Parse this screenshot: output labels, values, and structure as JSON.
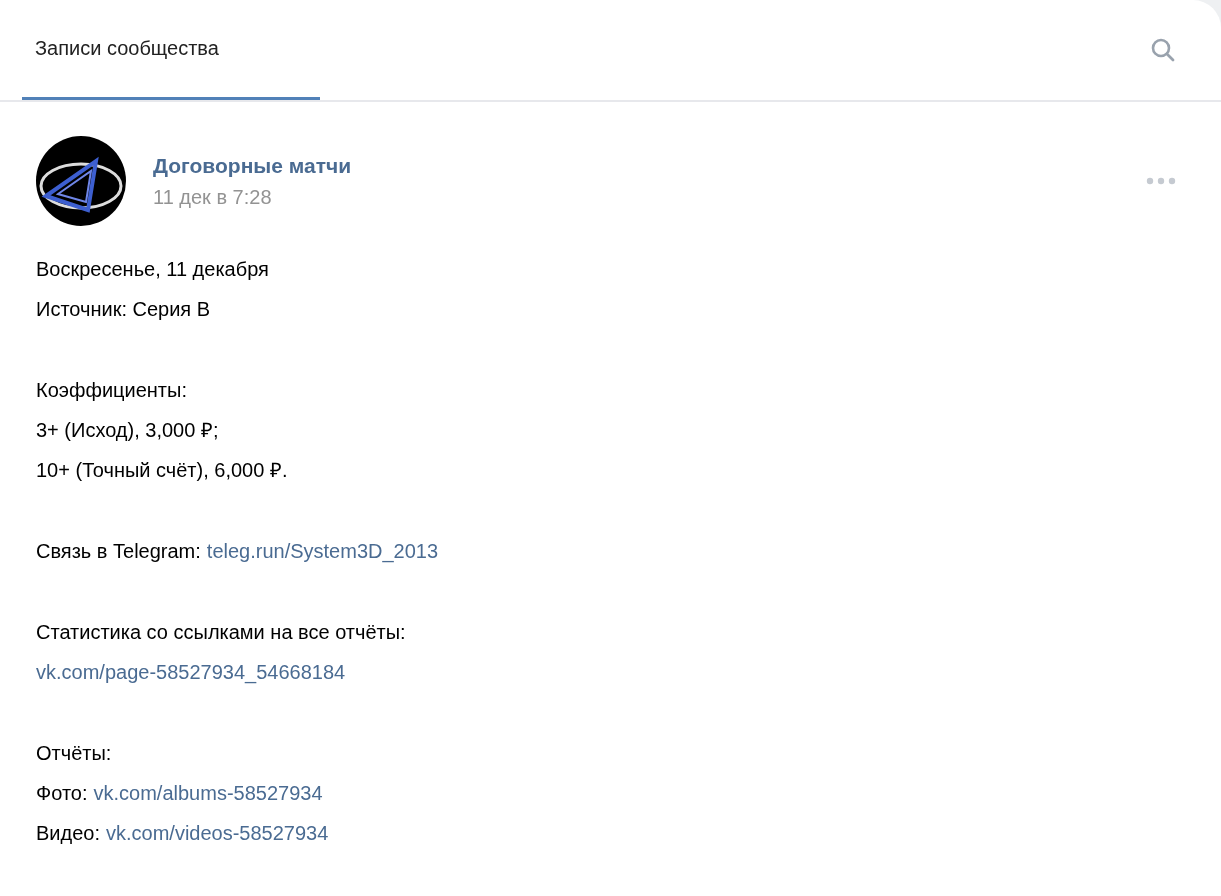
{
  "tabs": [
    {
      "label": "Записи сообщества",
      "selected": true
    }
  ],
  "post": {
    "author": "Договорные матчи",
    "date": "11 дек в 7:28",
    "paragraphs": [
      [
        [
          {
            "kind": "text",
            "text": "Воскресенье, 11 декабря"
          }
        ],
        [
          {
            "kind": "text",
            "text": "Источник: Серия B"
          }
        ]
      ],
      [
        [
          {
            "kind": "text",
            "text": "Коэффициенты:"
          }
        ],
        [
          {
            "kind": "text",
            "text": "3+ (Исход), 3,000 ₽;"
          }
        ],
        [
          {
            "kind": "text",
            "text": "10+ (Точный счёт), 6,000 ₽."
          }
        ]
      ],
      [
        [
          {
            "kind": "text",
            "text": "Связь в Telegram:"
          },
          {
            "kind": "link",
            "text": "teleg.run/System3D_2013"
          }
        ]
      ],
      [
        [
          {
            "kind": "text",
            "text": "Статистика со ссылками на все отчёты:"
          }
        ],
        [
          {
            "kind": "link",
            "text": "vk.com/page-58527934_54668184"
          }
        ]
      ],
      [
        [
          {
            "kind": "text",
            "text": "Отчёты:"
          }
        ],
        [
          {
            "kind": "text",
            "text": "Фото:"
          },
          {
            "kind": "link",
            "text": "vk.com/albums-58527934"
          }
        ],
        [
          {
            "kind": "text",
            "text": "Видео:"
          },
          {
            "kind": "link",
            "text": "vk.com/videos-58527934"
          }
        ]
      ]
    ]
  }
}
